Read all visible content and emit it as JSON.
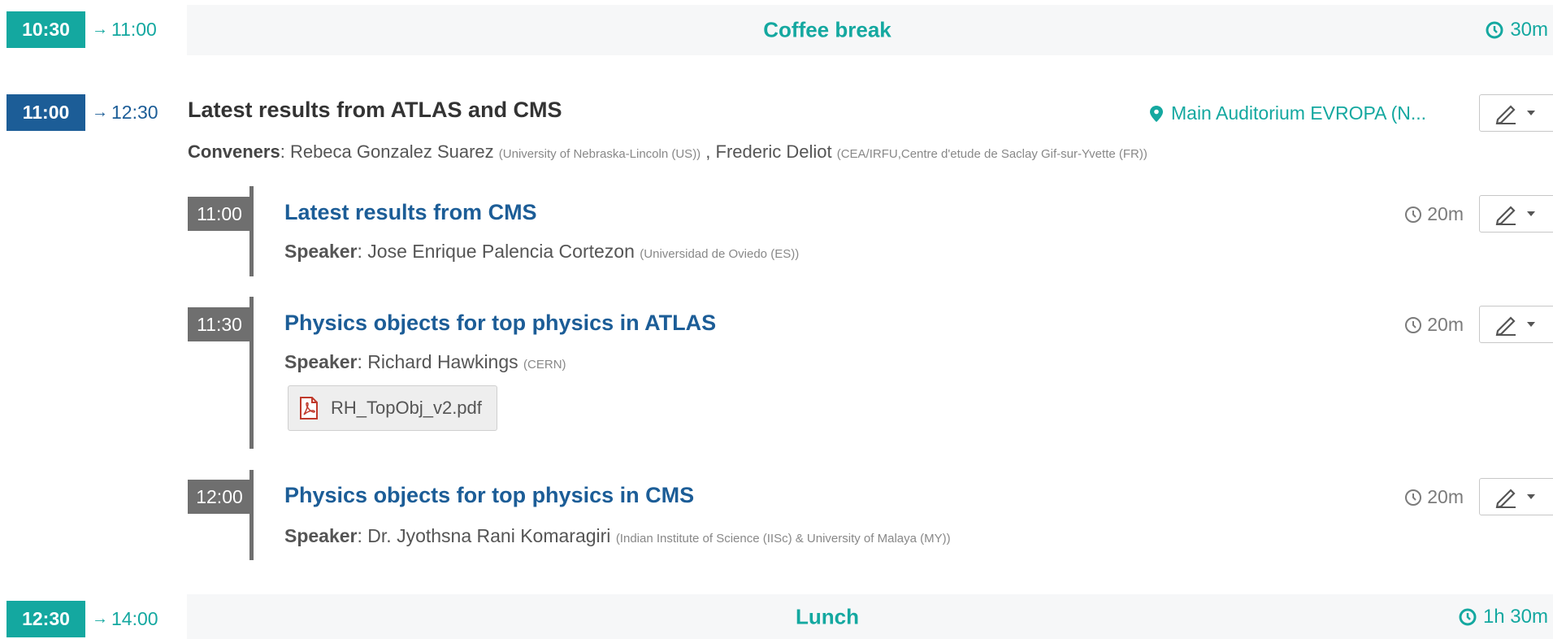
{
  "entries": [
    {
      "start": "10:30",
      "end": "11:00",
      "title": "Coffee break",
      "duration": "30m"
    },
    {
      "start": "11:00",
      "end": "12:30",
      "title": "Latest results from ATLAS and CMS",
      "location": "Main Auditorium EVROPA (N...",
      "conveners_label": "Conveners",
      "conveners": [
        {
          "name": "Rebeca Gonzalez Suarez",
          "affiliation": "(University of Nebraska-Lincoln (US))"
        },
        {
          "name": "Frederic Deliot",
          "affiliation": "(CEA/IRFU,Centre d'etude de Saclay Gif-sur-Yvette (FR))"
        }
      ]
    },
    {
      "start": "12:30",
      "end": "14:00",
      "title": "Lunch",
      "duration": "1h 30m"
    }
  ],
  "contributions": [
    {
      "time": "11:00",
      "title": "Latest results from CMS",
      "speaker_label": "Speaker",
      "speaker": "Jose Enrique Palencia Cortezon",
      "affiliation": "(Universidad de Oviedo (ES))",
      "duration": "20m"
    },
    {
      "time": "11:30",
      "title": "Physics objects for top physics in ATLAS",
      "speaker_label": "Speaker",
      "speaker": "Richard Hawkings",
      "affiliation": "(CERN)",
      "duration": "20m",
      "attachment": "RH_TopObj_v2.pdf"
    },
    {
      "time": "12:00",
      "title": "Physics objects for top physics in CMS",
      "speaker_label": "Speaker",
      "speaker": "Dr. Jyothsna Rani Komaragiri",
      "affiliation": "(Indian Institute of Science (IISc) & University of Malaya (MY))",
      "duration": "20m"
    }
  ],
  "colors": {
    "accent": "#14a8a0",
    "session": "#1c5d97",
    "contribution_badge": "#6f6f6f"
  },
  "icons": {
    "clock": "clock-icon",
    "location": "map-marker-icon",
    "edit": "pencil-icon",
    "pdf": "pdf-file-icon"
  }
}
